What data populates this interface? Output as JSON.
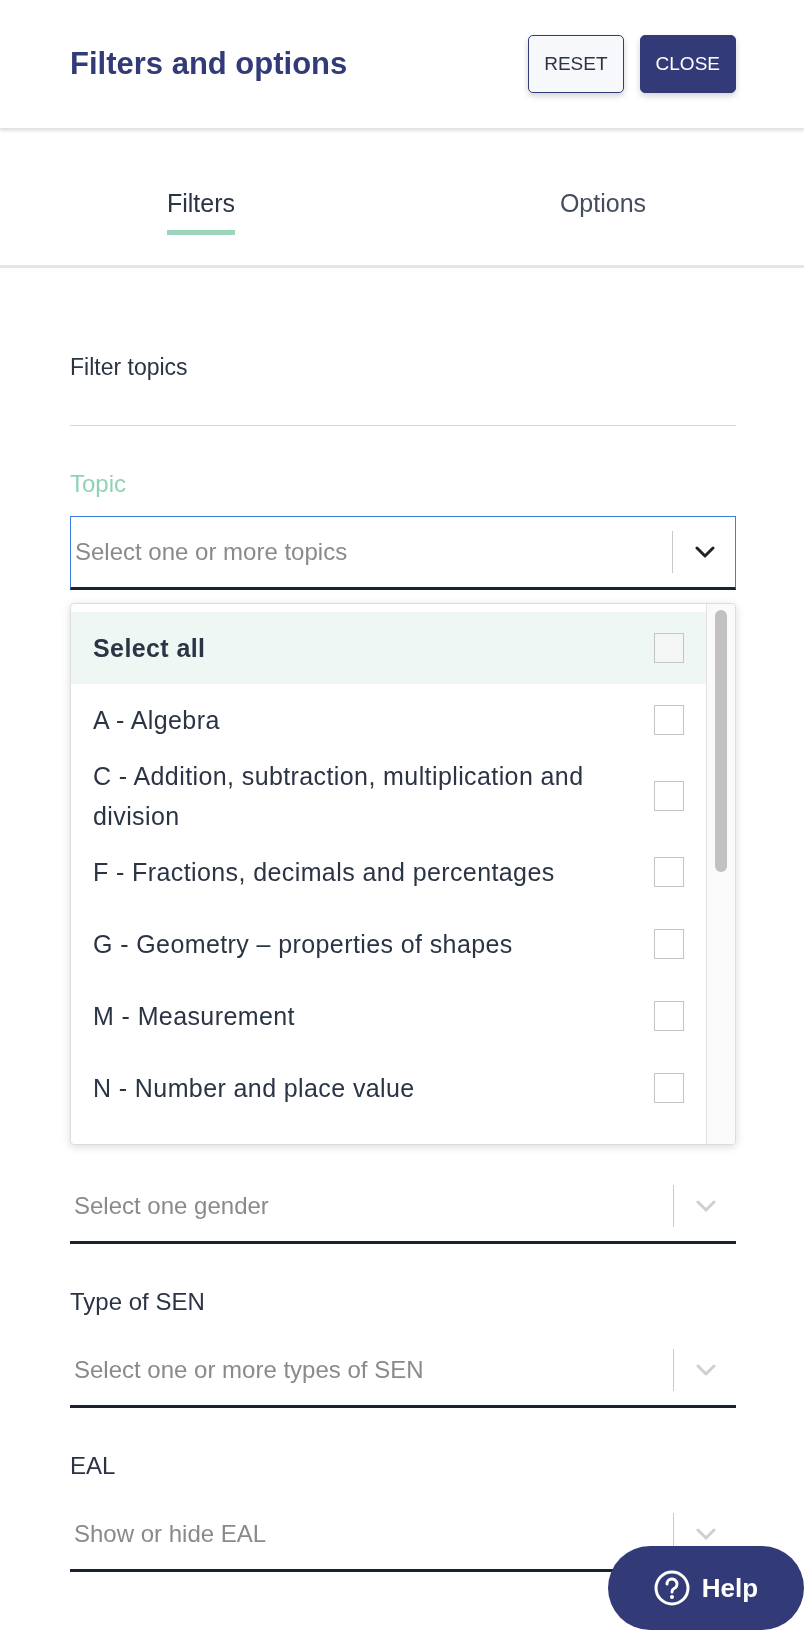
{
  "header": {
    "title": "Filters and options",
    "buttons": [
      {
        "label": "RESET",
        "kind": "secondary"
      },
      {
        "label": "CLOSE",
        "kind": "primary"
      }
    ]
  },
  "tabs": [
    {
      "label": "Filters",
      "selected": true
    },
    {
      "label": "Options",
      "selected": false
    }
  ],
  "section_title": "Filter topics",
  "topic": {
    "label": "Topic",
    "placeholder": "Select one or more topics",
    "focused": true,
    "options": [
      {
        "label": "Select all",
        "kind": "all",
        "highlighted": true,
        "checked": false
      },
      {
        "label": "A - Algebra",
        "kind": "topic",
        "highlighted": false,
        "checked": false
      },
      {
        "label": "C - Addition, subtraction, multiplication and division",
        "kind": "topic",
        "highlighted": false,
        "checked": false
      },
      {
        "label": "F - Fractions, decimals and percentages",
        "kind": "topic",
        "highlighted": false,
        "checked": false
      },
      {
        "label": "G - Geometry – properties of shapes",
        "kind": "topic",
        "highlighted": false,
        "checked": false
      },
      {
        "label": "M - Measurement",
        "kind": "topic",
        "highlighted": false,
        "checked": false
      },
      {
        "label": "N - Number and place value",
        "kind": "topic",
        "highlighted": false,
        "checked": false
      }
    ]
  },
  "fields": [
    {
      "placeholder": "Select one gender"
    },
    {
      "label": "Type of SEN",
      "placeholder": "Select one or more types of SEN"
    },
    {
      "label": "EAL",
      "placeholder": "Show or hide EAL"
    }
  ],
  "help_button": {
    "label": "Help"
  }
}
